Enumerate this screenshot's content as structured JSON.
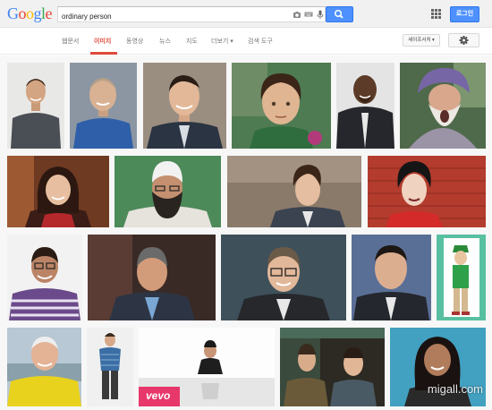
{
  "logo": {
    "text": "Google"
  },
  "search": {
    "query": "ordinary person"
  },
  "header": {
    "signin_label": "로그인"
  },
  "nav": {
    "tabs": [
      {
        "label": "웹문서"
      },
      {
        "label": "이미지"
      },
      {
        "label": "동영상"
      },
      {
        "label": "뉴스"
      },
      {
        "label": "지도"
      },
      {
        "label": "더보기 ▾"
      },
      {
        "label": "검색 도구"
      }
    ],
    "safesearch_label": "세이프서치 ▾"
  },
  "images": {
    "overlay_logo": "vevo",
    "watermark": "migall.com"
  },
  "colors": {
    "accent_red": "#dd4b39",
    "search_blue": "#4d90fe"
  }
}
